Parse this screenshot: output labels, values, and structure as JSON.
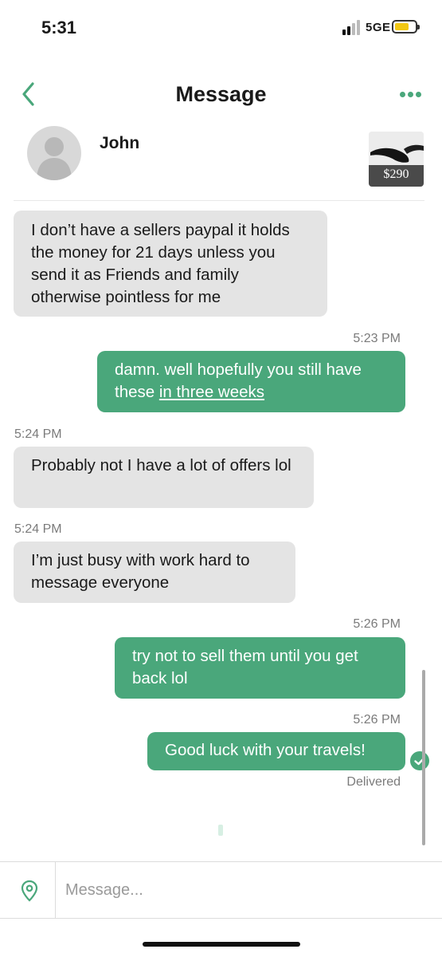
{
  "status_bar": {
    "time": "5:31",
    "network": "5GE"
  },
  "header": {
    "title": "Message"
  },
  "contact": {
    "name": "John"
  },
  "product": {
    "price": "$290"
  },
  "messages": [
    {
      "from": "other",
      "timestamp": "",
      "text": "I don’t have a sellers paypal it holds the money for 21 days unless you send it as Friends and family otherwise pointless for me"
    },
    {
      "from": "me",
      "timestamp": "5:23 PM",
      "text_before_link": "damn. well hopefully you still have these ",
      "link_text": "in three weeks"
    },
    {
      "from": "other",
      "timestamp": "5:24 PM",
      "text": "Probably not I have a lot of offers lol"
    },
    {
      "from": "other",
      "timestamp": "5:24 PM",
      "text": "I’m just busy with work hard to message everyone"
    },
    {
      "from": "me",
      "timestamp": "5:26 PM",
      "text": "try not to sell them until you get back lol"
    },
    {
      "from": "me",
      "timestamp": "5:26 PM",
      "text": "Good luck with your travels!"
    }
  ],
  "delivery_status": "Delivered",
  "composer": {
    "placeholder": "Message..."
  },
  "colors": {
    "accent": "#4aa77b",
    "incoming_bubble": "#e4e4e4",
    "battery": "#f2c814"
  },
  "icons": [
    "back-chevron-icon",
    "more-dots-icon",
    "avatar-placeholder-icon",
    "check-icon",
    "location-pin-icon"
  ]
}
